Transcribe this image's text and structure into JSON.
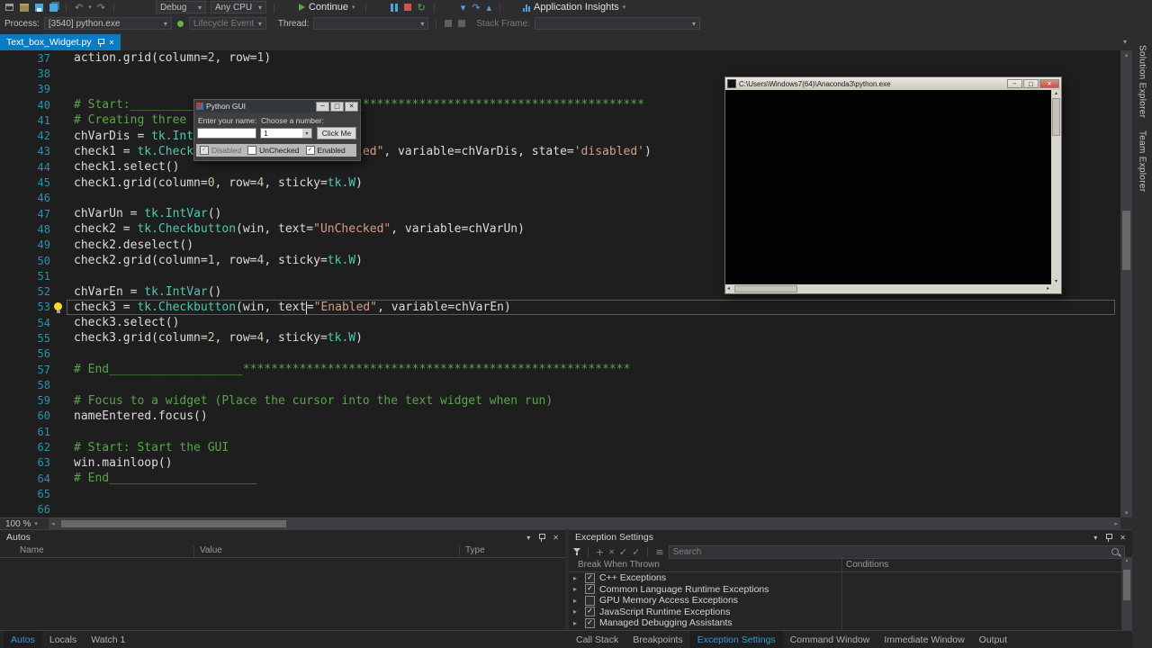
{
  "glyphs": {
    "chevron_down": "▾",
    "close": "✕",
    "minimize": "─",
    "maximize": "□",
    "undo": "↶",
    "redo": "↷",
    "restart": "↻",
    "scroll_up": "▴",
    "scroll_down": "▾",
    "scroll_left": "◂",
    "scroll_right": "▸",
    "plus": "+",
    "check": "✓",
    "menu": "≡",
    "expander": "▸"
  },
  "toolbar": {
    "debug": "Debug",
    "cpu": "Any CPU",
    "continue_label": "Continue",
    "app_insights": "Application Insights"
  },
  "debug_bar": {
    "process_label": "Process:",
    "process_value": "[3540] python.exe",
    "lifecycle": "Lifecycle Events",
    "thread_label": "Thread:",
    "stack_frame_label": "Stack Frame:"
  },
  "tabstrip": {
    "doc_tab": "Text_box_Widget.py"
  },
  "editor": {
    "zoom": "100 %",
    "current_line": 53,
    "lines": [
      {
        "n": 37,
        "segs": [
          [
            "p",
            "action.grid(column="
          ],
          [
            "n",
            "2"
          ],
          [
            "p",
            ", row="
          ],
          [
            "n",
            "1"
          ],
          [
            "p",
            ")"
          ]
        ]
      },
      {
        "n": 38,
        "segs": []
      },
      {
        "n": 39,
        "segs": []
      },
      {
        "n": 40,
        "segs": [
          [
            "c",
            "# Start:_________________________________****************************************"
          ]
        ]
      },
      {
        "n": 41,
        "segs": [
          [
            "c",
            "# Creating three checkbuttons"
          ]
        ]
      },
      {
        "n": 42,
        "segs": [
          [
            "p",
            "chVarDis = "
          ],
          [
            "t",
            "tk.IntVar"
          ],
          [
            "p",
            "()"
          ]
        ]
      },
      {
        "n": 43,
        "segs": [
          [
            "p",
            "check1 = "
          ],
          [
            "t",
            "tk.Checkbutton"
          ],
          [
            "p",
            "(win, text="
          ],
          [
            "s",
            "\"Disabled\""
          ],
          [
            "p",
            ", variable=chVarDis, state="
          ],
          [
            "s",
            "'disabled'"
          ],
          [
            "p",
            ")"
          ]
        ]
      },
      {
        "n": 44,
        "segs": [
          [
            "p",
            "check1.select()"
          ]
        ]
      },
      {
        "n": 45,
        "segs": [
          [
            "p",
            "check1.grid(column="
          ],
          [
            "n",
            "0"
          ],
          [
            "p",
            ", row="
          ],
          [
            "n",
            "4"
          ],
          [
            "p",
            ", sticky="
          ],
          [
            "t",
            "tk.W"
          ],
          [
            "p",
            ")"
          ]
        ]
      },
      {
        "n": 46,
        "segs": []
      },
      {
        "n": 47,
        "segs": [
          [
            "p",
            "chVarUn = "
          ],
          [
            "t",
            "tk.IntVar"
          ],
          [
            "p",
            "()"
          ]
        ]
      },
      {
        "n": 48,
        "segs": [
          [
            "p",
            "check2 = "
          ],
          [
            "t",
            "tk.Checkbutton"
          ],
          [
            "p",
            "(win, text="
          ],
          [
            "s",
            "\"UnChecked\""
          ],
          [
            "p",
            ", variable=chVarUn)"
          ]
        ]
      },
      {
        "n": 49,
        "segs": [
          [
            "p",
            "check2.deselect()"
          ]
        ]
      },
      {
        "n": 50,
        "segs": [
          [
            "p",
            "check2.grid(column="
          ],
          [
            "n",
            "1"
          ],
          [
            "p",
            ", row="
          ],
          [
            "n",
            "4"
          ],
          [
            "p",
            ", sticky="
          ],
          [
            "t",
            "tk.W"
          ],
          [
            "p",
            ")"
          ]
        ]
      },
      {
        "n": 51,
        "segs": []
      },
      {
        "n": 52,
        "segs": [
          [
            "p",
            "chVarEn = "
          ],
          [
            "t",
            "tk.IntVar"
          ],
          [
            "p",
            "()"
          ]
        ]
      },
      {
        "n": 53,
        "segs": [
          [
            "p",
            "check3 = "
          ],
          [
            "t",
            "tk.Checkbutton"
          ],
          [
            "p",
            "(win, text"
          ],
          [
            "caret",
            ""
          ],
          [
            "p",
            "="
          ],
          [
            "s",
            "\"Enabled\""
          ],
          [
            "p",
            ", variable=chVarEn)"
          ]
        ]
      },
      {
        "n": 54,
        "segs": [
          [
            "p",
            "check3.select()"
          ]
        ]
      },
      {
        "n": 55,
        "segs": [
          [
            "p",
            "check3.grid(column="
          ],
          [
            "n",
            "2"
          ],
          [
            "p",
            ", row="
          ],
          [
            "n",
            "4"
          ],
          [
            "p",
            ", sticky="
          ],
          [
            "t",
            "tk.W"
          ],
          [
            "p",
            ")"
          ]
        ]
      },
      {
        "n": 56,
        "segs": []
      },
      {
        "n": 57,
        "segs": [
          [
            "c",
            "# End___________________*******************************************************"
          ]
        ]
      },
      {
        "n": 58,
        "segs": []
      },
      {
        "n": 59,
        "segs": [
          [
            "c",
            "# Focus to a widget (Place the cursor into the text widget when run)"
          ]
        ]
      },
      {
        "n": 60,
        "segs": [
          [
            "p",
            "nameEntered.focus()"
          ]
        ]
      },
      {
        "n": 61,
        "segs": []
      },
      {
        "n": 62,
        "segs": [
          [
            "c",
            "# Start: Start the GUI"
          ]
        ]
      },
      {
        "n": 63,
        "segs": [
          [
            "p",
            "win.mainloop()"
          ]
        ]
      },
      {
        "n": 64,
        "segs": [
          [
            "c",
            "# End_____________________"
          ]
        ]
      },
      {
        "n": 65,
        "segs": []
      },
      {
        "n": 66,
        "segs": []
      }
    ]
  },
  "dialog": {
    "title": "Python GUI",
    "name_label": "Enter your name:",
    "number_label": "Choose a number:",
    "combo_value": "1",
    "button_label": "Click Me",
    "checkboxes": [
      {
        "label": "Disabled",
        "checked": true,
        "dim": true
      },
      {
        "label": "UnChecked",
        "checked": false,
        "dim": false
      },
      {
        "label": "Enabled",
        "checked": true,
        "dim": false
      }
    ]
  },
  "console": {
    "title": "C:\\Users\\Windows7(64)\\Anaconda3\\python.exe"
  },
  "rail": {
    "tabs": [
      "Solution Explorer",
      "Team Explorer"
    ]
  },
  "autos": {
    "title": "Autos",
    "columns": [
      "Name",
      "Value",
      "Type"
    ],
    "tabs": [
      {
        "label": "Autos",
        "active": true
      },
      {
        "label": "Locals",
        "active": false
      },
      {
        "label": "Watch 1",
        "active": false
      }
    ]
  },
  "exceptions": {
    "title": "Exception Settings",
    "search_placeholder": "Search",
    "col_break": "Break When Thrown",
    "col_conditions": "Conditions",
    "rows": [
      {
        "label": "C++ Exceptions",
        "checked": true
      },
      {
        "label": "Common Language Runtime Exceptions",
        "checked": true
      },
      {
        "label": "GPU Memory Access Exceptions",
        "checked": false
      },
      {
        "label": "JavaScript Runtime Exceptions",
        "checked": true
      },
      {
        "label": "Managed Debugging Assistants",
        "checked": true
      }
    ],
    "tabs": [
      {
        "label": "Call Stack",
        "active": false
      },
      {
        "label": "Breakpoints",
        "active": false
      },
      {
        "label": "Exception Settings",
        "active": true
      },
      {
        "label": "Command Window",
        "active": false
      },
      {
        "label": "Immediate Window",
        "active": false
      },
      {
        "label": "Output",
        "active": false
      }
    ]
  }
}
